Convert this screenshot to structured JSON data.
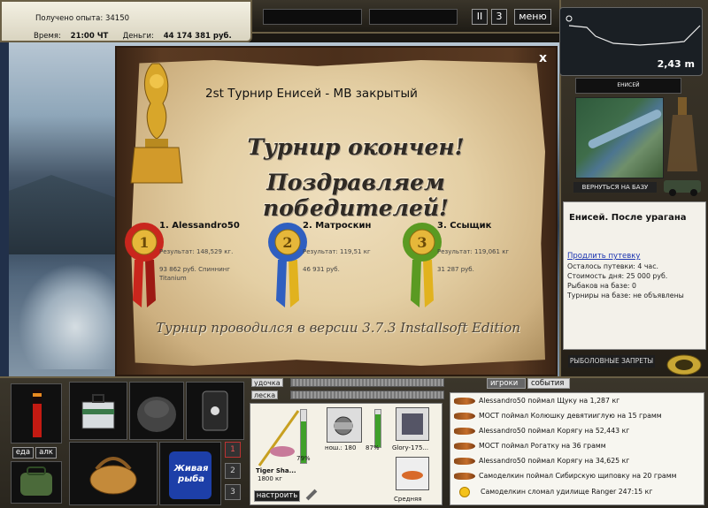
{
  "stats": {
    "experience_label": "Получено опыта:",
    "experience_value": "34150",
    "time_label": "Время:",
    "time_value": "21:00 ЧТ",
    "money_label": "Деньги:",
    "money_value": "44 174 381 руб."
  },
  "topbar": {
    "pause_label": "II",
    "speed_label": "3",
    "menu_label": "меню"
  },
  "depth": {
    "value": "2,43 m"
  },
  "location_map": {
    "title": "ЕНИСЕЙ",
    "back_label": "ВЕРНУТЬСЯ НА БАЗУ"
  },
  "info": {
    "title": "Енисей. После урагана",
    "extend_link": "Продлить путевку",
    "remaining": "Осталось путевки: 4 час.",
    "cost": "Стоимость дня: 25 000 руб.",
    "fishers": "Рыбаков на базе: 0",
    "tournaments": "Турниры на базе: не объявлены",
    "bans_label": "РЫБОЛОВНЫЕ ЗАПРЕТЫ"
  },
  "dialog": {
    "close_label": "x",
    "title": "2st Турнир Енисей - МВ закрытый",
    "line1": "Турнир окончен!",
    "line2": "Поздравляем победителей!",
    "winners": [
      {
        "rank": "1",
        "name": "1. Alessandro50",
        "result": "Результат: 148,529 кг.",
        "prize": "93 862 руб. Спиннинг Titanium",
        "color": "#c9261d"
      },
      {
        "rank": "2",
        "name": "2. Матроскин",
        "result": "Результат: 119,51 кг",
        "prize": "46 931 руб.",
        "color": "#2f5fc0"
      },
      {
        "rank": "3",
        "name": "3. Ссыщик",
        "result": "Результат: 119,061 кг",
        "prize": "31 287 руб.",
        "color": "#5a9a22"
      }
    ],
    "footer": "Турнир проводился в версии 3.7.3 Installsoft Edition"
  },
  "bottom": {
    "eat_label": "еда",
    "alc_label": "алк",
    "bucket_text": "Живая рыба",
    "slot_numbers": [
      "1",
      "2",
      "3"
    ],
    "rod_label": "удочка",
    "line_label": "леска",
    "rod_name": "Tiger Sha...",
    "rod_weight": "1800 кг",
    "rod_percent": "79%",
    "reel_info": "нош.: 180",
    "reel_percent": "87%",
    "bait_name": "Glory-175...",
    "lure_label": "Средняя",
    "setup_label": "настроить"
  },
  "tabs": [
    "игроки",
    "события"
  ],
  "log": [
    "Alessandro50 поймал Щуку на 1,287 кг",
    "МОСТ поймал Колюшку девятииглую на 15 грамм",
    "Alessandro50 поймал Корягу на 52,443 кг",
    "МОСТ поймал Рогатку на 36 грамм",
    "Alessandro50 поймал Корягу на 34,625 кг",
    "Самоделкин поймал Сибирскую щиповку на 20 грамм",
    "Самоделкин сломал удилище Ranger 247:15 кг"
  ]
}
